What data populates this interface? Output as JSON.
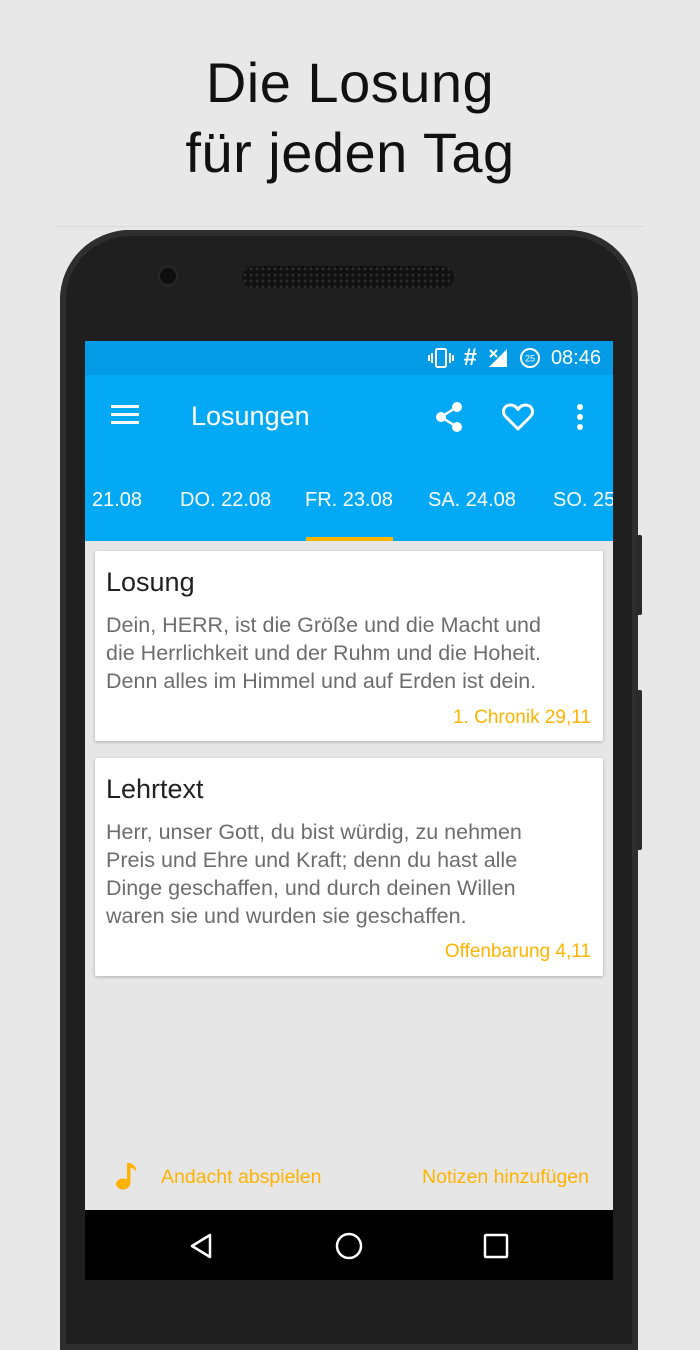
{
  "promo": {
    "line1": "Die Losung",
    "line2": "für jeden Tag"
  },
  "status_bar": {
    "time": "08:46",
    "icons": [
      "vibrate-icon",
      "hash-icon",
      "signal-no-data-icon",
      "battery-icon"
    ],
    "battery_label": "25"
  },
  "app_bar": {
    "title": "Losungen",
    "actions": [
      "share-icon",
      "heart-icon",
      "more-vert-icon"
    ]
  },
  "tabs": [
    {
      "label": "21.08"
    },
    {
      "label": "DO. 22.08"
    },
    {
      "label": "FR. 23.08",
      "selected": true
    },
    {
      "label": "SA. 24.08"
    },
    {
      "label": "SO. 25"
    }
  ],
  "cards": {
    "losung": {
      "title": "Losung",
      "lines": [
        "Dein, HERR, ist die Größe und die Macht und",
        "die Herrlichkeit und der Ruhm und die Hoheit.",
        "Denn alles im Himmel und auf Erden ist dein."
      ],
      "reference": "1. Chronik 29,11"
    },
    "lehrtext": {
      "title": "Lehrtext",
      "lines": [
        "Herr, unser Gott, du bist würdig, zu nehmen",
        "Preis und Ehre und Kraft; denn du hast alle",
        "Dinge geschaffen, und durch deinen Willen",
        "waren sie und wurden sie geschaffen."
      ],
      "reference": "Offenbarung 4,11"
    }
  },
  "bottom_actions": {
    "play_label": "Andacht abspielen",
    "notes_label": "Notizen hinzufügen"
  },
  "nav": [
    "back-icon",
    "home-icon",
    "recents-icon"
  ],
  "colors": {
    "primary": "#03a9f4",
    "status": "#039be5",
    "accent": "#ffb300"
  }
}
